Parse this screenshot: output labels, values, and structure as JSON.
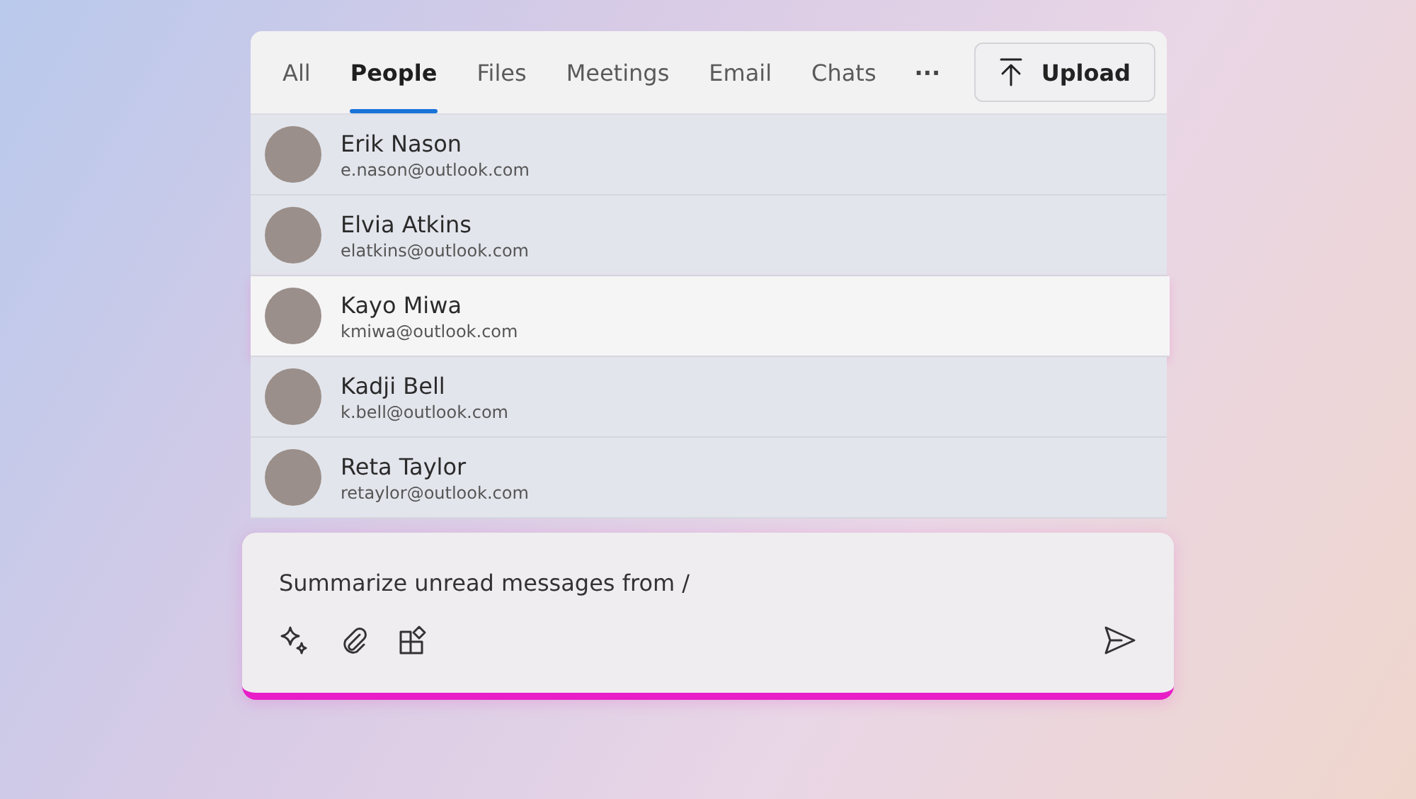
{
  "tabs": [
    {
      "label": "All",
      "selected": false
    },
    {
      "label": "People",
      "selected": true
    },
    {
      "label": "Files",
      "selected": false
    },
    {
      "label": "Meetings",
      "selected": false
    },
    {
      "label": "Email",
      "selected": false
    },
    {
      "label": "Chats",
      "selected": false
    }
  ],
  "more_label": "···",
  "upload_button": {
    "label": "Upload"
  },
  "people": [
    {
      "name": "Erik Nason",
      "email": "e.nason@outlook.com",
      "selected": false
    },
    {
      "name": "Elvia Atkins",
      "email": "elatkins@outlook.com",
      "selected": false
    },
    {
      "name": "Kayo Miwa",
      "email": "kmiwa@outlook.com",
      "selected": true
    },
    {
      "name": "Kadji Bell",
      "email": "k.bell@outlook.com",
      "selected": false
    },
    {
      "name": "Reta Taylor",
      "email": "retaylor@outlook.com",
      "selected": false
    }
  ],
  "composer": {
    "value": "Summarize unread messages from /"
  }
}
